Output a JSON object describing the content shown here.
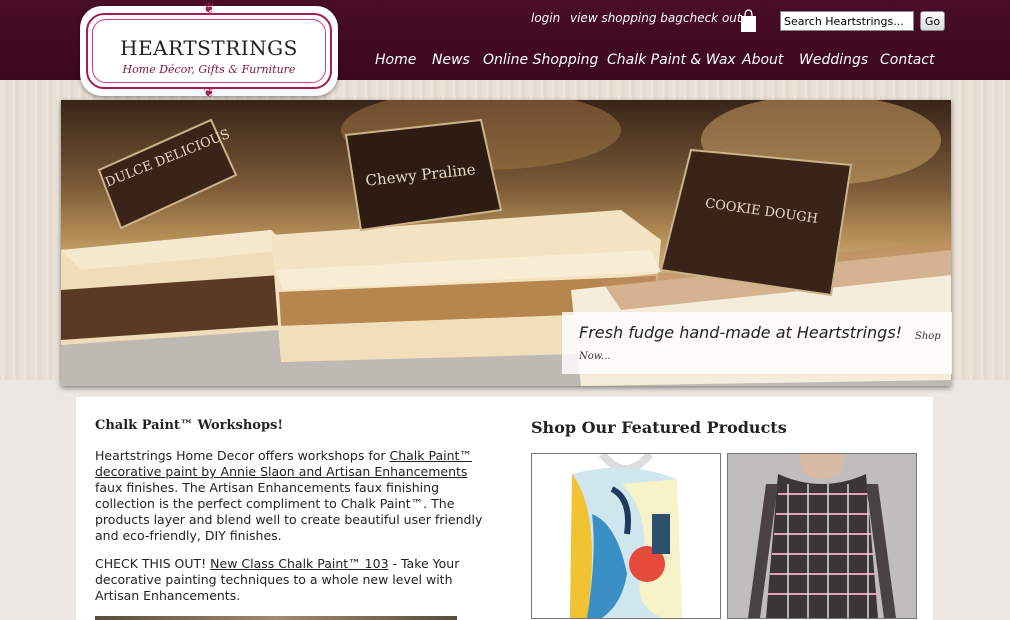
{
  "brand": {
    "title": "HEARTSTRINGS",
    "subtitle": "Home Décor, Gifts & Furniture",
    "accent": "#4a0d26",
    "logo_border": "#a31d55"
  },
  "util_links": {
    "login": "login",
    "bag": "view shopping bag",
    "checkout": "check out"
  },
  "search": {
    "placeholder": "Search Heartstrings...",
    "button": "Go"
  },
  "nav": [
    "Home",
    "News",
    "Online Shopping",
    "Chalk Paint & Wax",
    "About",
    "Weddings",
    "Contact"
  ],
  "hero": {
    "signs": [
      "DULCE DELICIOUS",
      "Chewy Praline",
      "COOKIE DOUGH"
    ],
    "caption": "Fresh fudge hand-made at Heartstrings!",
    "caption_link": "Shop Now..."
  },
  "workshop": {
    "title": "Chalk Paint™ Workshops!",
    "p1_pre": "Heartstrings Home Decor offers workshops for ",
    "p1_link": "Chalk Paint™ decorative paint by Annie Slaon and Artisan Enhancements",
    "p1_post": " faux finishes. The Artisan Enhancements faux finishing collection is the perfect compliment to Chalk Paint™. The products layer and blend well to create beautiful user friendly and eco-friendly, DIY finishes.",
    "p2_pre": "CHECK THIS OUT!  ",
    "p2_link": "New Class Chalk Paint™ 103",
    "p2_post": " - Take Your decorative painting techniques to a whole new level with Artisan Enhancements."
  },
  "featured": {
    "title": "Shop Our Featured Products",
    "products": [
      {
        "image": "printed-scarf-image"
      },
      {
        "image": "crochet-top-image"
      }
    ]
  }
}
